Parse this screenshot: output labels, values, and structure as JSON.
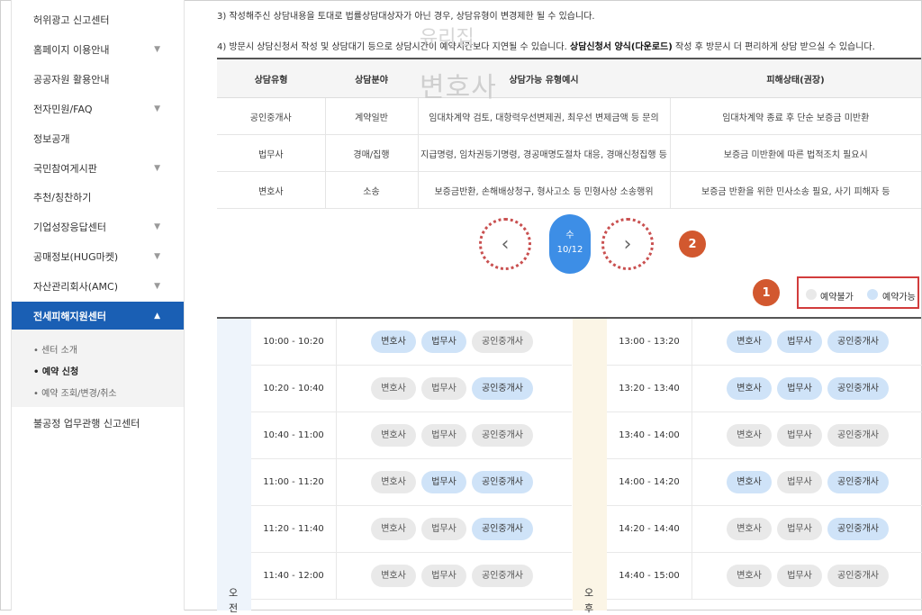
{
  "sidebar": {
    "items": [
      {
        "label": "허위광고 신고센터",
        "chevron": false
      },
      {
        "label": "홈페이지 이용안내",
        "chevron": true
      },
      {
        "label": "공공자원 활용안내",
        "chevron": false
      },
      {
        "label": "전자민원/FAQ",
        "chevron": true
      },
      {
        "label": "정보공개",
        "chevron": false
      },
      {
        "label": "국민참여게시판",
        "chevron": true
      },
      {
        "label": "추천/칭찬하기",
        "chevron": false
      },
      {
        "label": "기업성장응답센터",
        "chevron": true
      },
      {
        "label": "공매정보(HUG마켓)",
        "chevron": true
      },
      {
        "label": "자산관리회사(AMC)",
        "chevron": true
      },
      {
        "label": "전세피해지원센터",
        "chevron": true,
        "active": true
      }
    ],
    "sub_items": [
      {
        "label": "• 센터 소개"
      },
      {
        "label": "• 예약 신청",
        "active": true
      },
      {
        "label": "• 예약 조회/변경/취소"
      }
    ],
    "last_item": "불공정 업무관행 신고센터",
    "chevron_down": "▼",
    "chevron_up": "▲"
  },
  "notes": {
    "note3": "3) 작성해주신 상담내용을 토대로 법률상담대상자가 아닌 경우, 상담유형이 변경제한 될 수 있습니다.",
    "note4_a": "4) 방문시 상담신청서 작성 및 상담대기 등으로 상담시간이 예약시간보다 지연될 수 있습니다. ",
    "note4_b": "상담신청서 양식(다운로드)",
    "note4_c": " 작성 후 방문시 더 편리하게 상담 받으실 수 있습니다."
  },
  "watermark": {
    "line1": "유리집",
    "line2": "변호사"
  },
  "info_table": {
    "headers": [
      "상담유형",
      "상담분야",
      "상담가능 유형예시",
      "피해상태(권장)"
    ],
    "rows": [
      [
        "공인중개사",
        "계약일반",
        "임대차계약 검토, 대항력우선변제권, 최우선 변제금액 등 문의",
        "임대차계약 종료 후 단순 보증금 미반환"
      ],
      [
        "법무사",
        "경매/집행",
        "지급명령, 임차권등기명령, 경공매명도절차 대응, 경매신청집행 등",
        "보증금 미반환에 따른 법적조치 필요시"
      ],
      [
        "변호사",
        "소송",
        "보증금반환, 손해배상청구, 형사고소 등 민형사상 소송행위",
        "보증금 반환을 위한 민사소송 필요, 사기 피해자 등"
      ]
    ]
  },
  "date_nav": {
    "prev_icon": "‹",
    "next_icon": "›",
    "day": "수",
    "date": "10/12",
    "badge2": "2",
    "badge1": "1"
  },
  "legend": {
    "unavailable": "예약불가",
    "available": "예약가능",
    "unavailable_color": "#e9e9e9",
    "available_color": "#cfe3f8"
  },
  "schedule": {
    "am_label": [
      "오",
      "전"
    ],
    "pm_label": [
      "오",
      "후"
    ],
    "types": [
      "변호사",
      "법무사",
      "공인중개사"
    ],
    "am": [
      {
        "time": "10:00 - 10:20",
        "avail": [
          true,
          true,
          false
        ]
      },
      {
        "time": "10:20 - 10:40",
        "avail": [
          false,
          false,
          true
        ]
      },
      {
        "time": "10:40 - 11:00",
        "avail": [
          false,
          false,
          false
        ]
      },
      {
        "time": "11:00 - 11:20",
        "avail": [
          false,
          true,
          true
        ]
      },
      {
        "time": "11:20 - 11:40",
        "avail": [
          false,
          false,
          true
        ]
      },
      {
        "time": "11:40 - 12:00",
        "avail": [
          false,
          false,
          false
        ]
      }
    ],
    "pm": [
      {
        "time": "13:00 - 13:20",
        "avail": [
          true,
          true,
          true
        ]
      },
      {
        "time": "13:20 - 13:40",
        "avail": [
          true,
          true,
          true
        ]
      },
      {
        "time": "13:40 - 14:00",
        "avail": [
          false,
          false,
          false
        ]
      },
      {
        "time": "14:00 - 14:20",
        "avail": [
          true,
          false,
          true
        ]
      },
      {
        "time": "14:20 - 14:40",
        "avail": [
          false,
          false,
          true
        ]
      },
      {
        "time": "14:40 - 15:00",
        "avail": [
          false,
          false,
          false
        ]
      }
    ]
  }
}
